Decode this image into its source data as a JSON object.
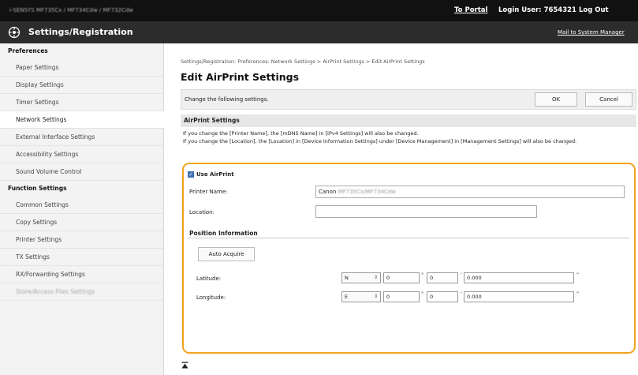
{
  "topbar": {
    "model": "i-SENSYS MF735Cx / MF734Cdw / MF732Cdw",
    "portal": "To Portal",
    "login_label": "Login User:",
    "login_user": "7654321",
    "logout": "Log Out"
  },
  "header": {
    "title": "Settings/Registration",
    "mail": "Mail to System Manager"
  },
  "sidebar": {
    "preferences": "Preferences",
    "pref_items": [
      "Paper Settings",
      "Display Settings",
      "Timer Settings",
      "Network Settings",
      "External Interface Settings",
      "Accessibility Settings",
      "Sound Volume Control"
    ],
    "function": "Function Settings",
    "func_items": [
      "Common Settings",
      "Copy Settings",
      "Printer Settings",
      "TX Settings",
      "RX/Forwarding Settings",
      "Store/Access Files Settings"
    ]
  },
  "main": {
    "breadcrumb": "Settings/Registration: Preferences: Network Settings > AirPrint Settings > Edit AirPrint Settings",
    "title": "Edit AirPrint Settings",
    "change_text": "Change the following settings.",
    "ok": "OK",
    "cancel": "Cancel",
    "section": "AirPrint Settings",
    "desc1": "If you change the [Printer Name], the [mDNS Name] in [IPv4 Settings] will also be changed.",
    "desc2": "If you change the [Location], the [Location] in [Device Information Settings] under [Device Management] in [Management Settings] will also be changed.",
    "use_airprint": "Use AirPrint",
    "printer_name_label": "Printer Name:",
    "printer_name_value": "Canon",
    "printer_name_model": "MF735Cx/MF734Cdw",
    "location_label": "Location:",
    "location_value": "",
    "position_info": "Position Information",
    "auto_acquire": "Auto Acquire",
    "latitude_label": "Latitude:",
    "longitude_label": "Longitude:",
    "lat": {
      "dir": "N",
      "deg": "0",
      "min": "0",
      "sec": "0.000"
    },
    "lon": {
      "dir": "E",
      "deg": "0",
      "min": "0",
      "sec": "0.000"
    },
    "deg_sym": "°",
    "min_sym": "'",
    "sec_sym": "\""
  },
  "colors": {
    "highlight": "#f2a21e",
    "topbar": "#111111",
    "header": "#2c2c2c"
  },
  "icons": {
    "header_logo": "settings-icon",
    "page_top": "page-top-arrow-icon"
  }
}
